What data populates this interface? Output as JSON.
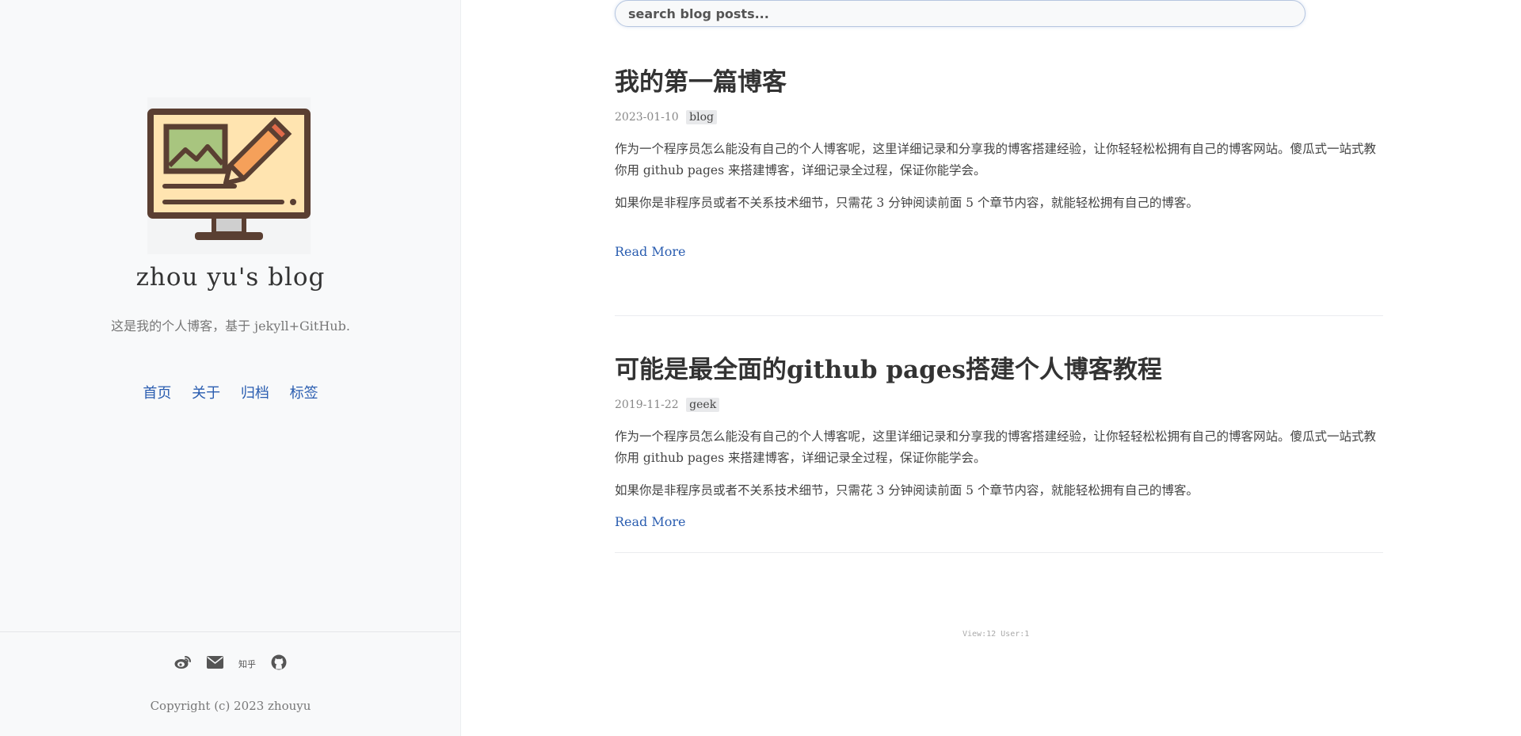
{
  "site": {
    "title": "zhou yu's blog",
    "description": "这是我的个人博客，基于 jekyll+GitHub.",
    "logo_icon": "monitor-with-image-and-pencil-icon"
  },
  "nav": [
    {
      "label": "首页"
    },
    {
      "label": "关于"
    },
    {
      "label": "归档"
    },
    {
      "label": "标签"
    }
  ],
  "social": {
    "weibo_icon": "weibo-icon",
    "email_icon": "envelope-icon",
    "zhihu_label": "知乎",
    "github_icon": "github-icon"
  },
  "footer": {
    "copyright": "Copyright (c) 2023 zhouyu"
  },
  "search": {
    "placeholder": "search blog posts..."
  },
  "posts": [
    {
      "title": "我的第一篇博客",
      "date": "2023-01-10",
      "tag": "blog",
      "excerpt_1": "作为一个程序员怎么能没有自己的个人博客呢，这里详细记录和分享我的博客搭建经验，让你轻轻松松拥有自己的博客网站。傻瓜式一站式教你用 github pages 来搭建博客，详细记录全过程，保证你能学会。",
      "excerpt_2": "如果你是非程序员或者不关系技术细节，只需花 3 分钟阅读前面 5 个章节内容，就能轻松拥有自己的博客。",
      "read_more": "Read More"
    },
    {
      "title": "可能是最全面的github pages搭建个人博客教程",
      "date": "2019-11-22",
      "tag": "geek",
      "excerpt_1": "作为一个程序员怎么能没有自己的个人博客呢，这里详细记录和分享我的博客搭建经验，让你轻轻松松拥有自己的博客网站。傻瓜式一站式教你用 github pages 来搭建博客，详细记录全过程，保证你能学会。",
      "excerpt_2": "如果你是非程序员或者不关系技术细节，只需花 3 分钟阅读前面 5 个章节内容，就能轻松拥有自己的博客。",
      "read_more": "Read More"
    }
  ],
  "stats": "View:12 User:1",
  "colors": {
    "link": "#2a5db0",
    "sidebar_bg": "#f8f9fa",
    "tag_bg": "#e8e9eb"
  }
}
